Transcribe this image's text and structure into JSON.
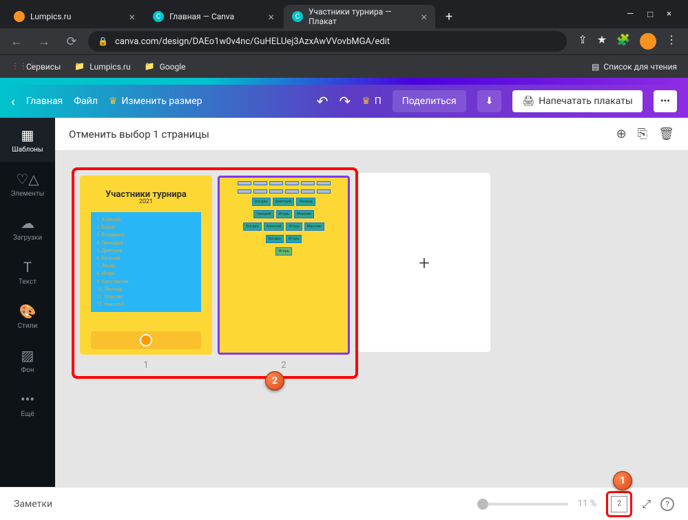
{
  "browser": {
    "tabs": [
      {
        "title": "Lumpics.ru"
      },
      {
        "title": "Главная — Canva"
      },
      {
        "title": "Участники турнира — Плакат"
      }
    ],
    "url": "canva.com/design/DAEo1w0v4nc/GuHELUej3AzxAwVVovbMGA/edit",
    "bookmarks": {
      "services": "Сервисы",
      "lumpics": "Lumpics.ru",
      "google": "Google",
      "reading": "Список для чтения"
    }
  },
  "toolbar": {
    "home": "Главная",
    "file": "Файл",
    "resize": "Изменить размер",
    "p": "П",
    "share": "Поделиться",
    "print": "Напечатать плакаты"
  },
  "sidebar": {
    "items": [
      {
        "label": "Шаблоны"
      },
      {
        "label": "Элементы"
      },
      {
        "label": "Загрузки"
      },
      {
        "label": "Текст"
      },
      {
        "label": "Стили"
      },
      {
        "label": "Фон"
      },
      {
        "label": "Ещё"
      }
    ]
  },
  "canvas": {
    "header": "Отменить выбор 1 страницы",
    "page1": "1",
    "page2": "2"
  },
  "thumb1": {
    "title": "Участники турнира",
    "year": "2021",
    "names": [
      "1. Алексей",
      "2. Борис",
      "3. Владимир",
      "4. Геннадий",
      "5. Дмитрий",
      "6. Евгений",
      "7. Захар",
      "8. Игорь",
      "9. Константин",
      "10. Леонид",
      "11. Максим",
      "12. Николай"
    ]
  },
  "thumb2": {
    "r1": [
      "Богдан",
      "Дмитрий",
      "Леонид"
    ],
    "r2": [
      "Генадий",
      "Игорь",
      "Максим"
    ],
    "r3": [
      "Богдан",
      "Алексей",
      "Игорь",
      "Максим"
    ],
    "r4": [
      "Богдан",
      "Игорь"
    ],
    "winner": "Игорь"
  },
  "footer": {
    "notes": "Заметки",
    "zoom": "11 %",
    "pageCount": "2"
  },
  "annotations": {
    "b1": "1",
    "b2": "2"
  }
}
